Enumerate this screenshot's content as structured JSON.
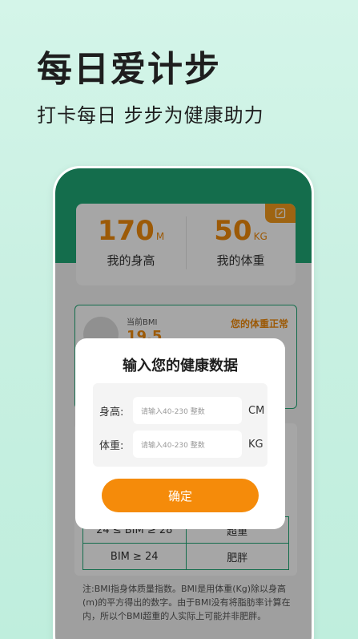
{
  "promo": {
    "title": "每日爱计步",
    "subtitle": "打卡每日 步步为健康助力"
  },
  "stats": {
    "height_value": "170",
    "height_unit": "M",
    "height_label": "我的身高",
    "weight_value": "50",
    "weight_unit": "KG",
    "weight_label": "我的体重",
    "edit_icon": "edit-icon"
  },
  "bmi": {
    "label": "当前BMI",
    "value": "19.5",
    "status": "您的体重正常"
  },
  "table": {
    "rows": [
      {
        "range": "24 ≤ BIM ≥ 28",
        "category": "超重"
      },
      {
        "range": "BIM ≥ 24",
        "category": "肥胖"
      }
    ]
  },
  "note": "注:BMI指身体质量指数。BMI是用体重(Kg)除以身高(m)的平方得出的数字。由于BMI没有将脂肪率计算在内，所以个BMI超重的人实际上可能并非肥胖。",
  "modal": {
    "title": "输入您的健康数据",
    "height_label": "身高:",
    "height_placeholder": "请输入40-230 整数",
    "height_unit": "CM",
    "weight_label": "体重:",
    "weight_placeholder": "请输入40-230 整数",
    "weight_unit": "KG",
    "confirm_label": "确定"
  },
  "colors": {
    "accent": "#1fa876",
    "orange": "#f08a0c",
    "background": "#c9f0e2"
  }
}
